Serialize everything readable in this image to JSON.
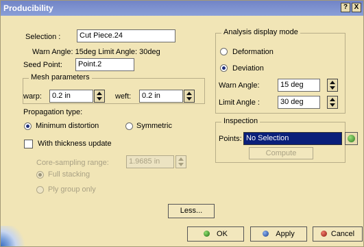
{
  "window": {
    "title": "Producibility",
    "help": "?",
    "close": "X"
  },
  "selection": {
    "label": "Selection :",
    "value": "Cut Piece.24",
    "angles": "Warn Angle: 15deg Limit Angle: 30deg"
  },
  "seed": {
    "label": "Seed Point:",
    "value": "Point.2"
  },
  "mesh": {
    "title": "Mesh parameters",
    "warp_label": "warp:",
    "warp_value": "0.2 in",
    "weft_label": "weft:",
    "weft_value": "0.2 in"
  },
  "propagation": {
    "label": "Propagation type:",
    "min_label": "Minimum distortion",
    "sym_label": "Symmetric"
  },
  "thickness": {
    "label": "With thickness update",
    "core_label": "Core-sampling range:",
    "core_value": "1.9685 in",
    "full_label": "Full stacking",
    "ply_label": "Ply group only"
  },
  "analysis": {
    "title": "Analysis display mode",
    "deformation": "Deformation",
    "deviation": "Deviation",
    "warn_label": "Warn Angle:",
    "warn_value": "15 deg",
    "limit_label": "Limit Angle :",
    "limit_value": "30 deg"
  },
  "inspection": {
    "title": "Inspection",
    "points_label": "Points:",
    "points_value": "No Selection",
    "compute": "Compute"
  },
  "buttons": {
    "less": "Less...",
    "ok": "OK",
    "apply": "Apply",
    "cancel": "Cancel"
  },
  "colors": {
    "background": "#f1e5b6",
    "title_bar": "#7f93d0",
    "selected_field": "#0a1f7a"
  }
}
